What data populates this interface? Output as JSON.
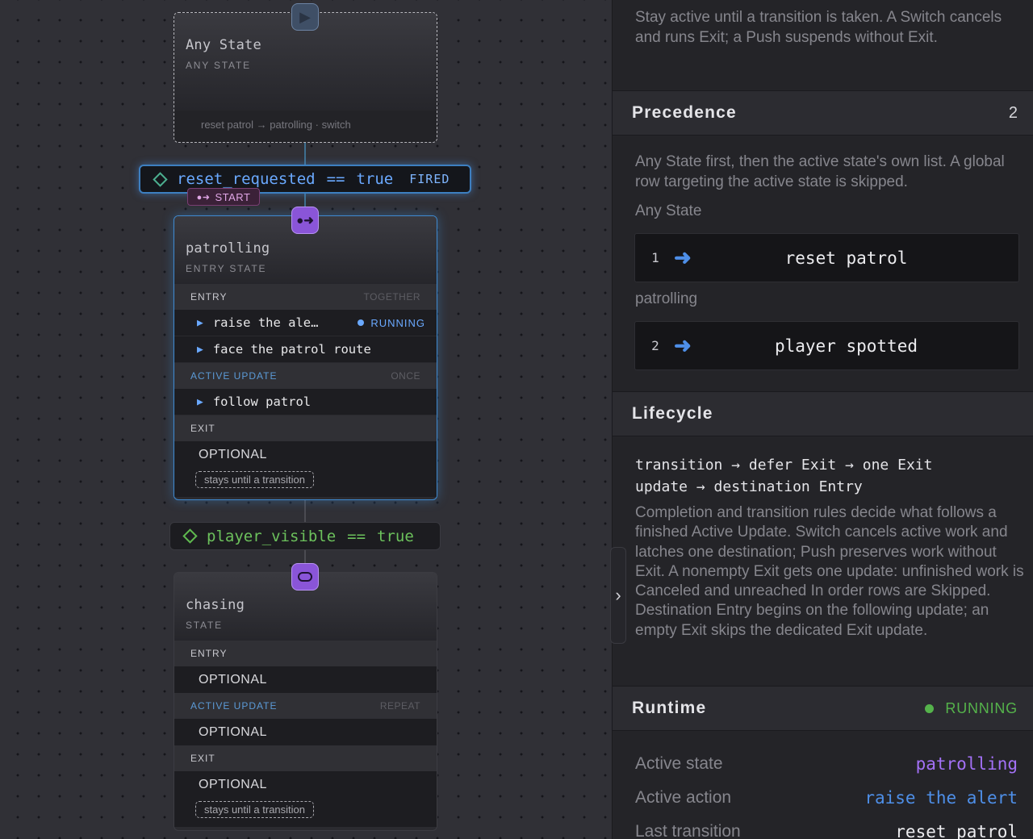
{
  "canvas": {
    "any_state": {
      "title": "Any State",
      "kind": "ANY STATE",
      "footer": "reset patrol → patrolling · switch"
    },
    "condition_reset": {
      "name": "reset_requested",
      "op": "==",
      "value": "true",
      "badge": "FIRED"
    },
    "start_badge": "START",
    "patrolling": {
      "title": "patrolling",
      "kind": "ENTRY STATE",
      "entry": {
        "label": "ENTRY",
        "mode": "TOGETHER",
        "rows": [
          {
            "text": "raise the ale…",
            "status": "RUNNING"
          },
          {
            "text": "face the patrol route"
          }
        ]
      },
      "active_update": {
        "label": "ACTIVE UPDATE",
        "mode": "ONCE",
        "rows": [
          {
            "text": "follow patrol"
          }
        ]
      },
      "exit": {
        "label": "EXIT",
        "optional": "OPTIONAL",
        "stays": "stays until a transition"
      }
    },
    "condition_player": {
      "name": "player_visible",
      "op": "==",
      "value": "true"
    },
    "chasing": {
      "title": "chasing",
      "kind": "STATE",
      "entry": {
        "label": "ENTRY",
        "optional": "OPTIONAL"
      },
      "active_update": {
        "label": "ACTIVE UPDATE",
        "mode": "REPEAT",
        "optional": "OPTIONAL"
      },
      "exit": {
        "label": "EXIT",
        "optional": "OPTIONAL",
        "stays": "stays until a transition"
      }
    }
  },
  "panel": {
    "intro_text": "Stay active until a transition is taken. A Switch cancels and runs Exit; a Push suspends without Exit.",
    "precedence": {
      "title": "Precedence",
      "count": "2",
      "description": "Any State first, then the active state's own list. A global row targeting the active state is skipped.",
      "groups": [
        {
          "name": "Any State",
          "index": "1",
          "label": "reset patrol"
        },
        {
          "name": "patrolling",
          "index": "2",
          "label": "player spotted"
        }
      ]
    },
    "lifecycle": {
      "title": "Lifecycle",
      "flow_line1": "transition → defer Exit → one Exit",
      "flow_line2": "update → destination Entry",
      "description": "Completion and transition rules decide what follows a finished Active Update. Switch cancels active work and latches one destination; Push preserves work without Exit. A nonempty Exit gets one update: unfinished work is Canceled and unreached In order rows are Skipped. Destination Entry begins on the following update; an empty Exit skips the dedicated Exit update."
    },
    "runtime": {
      "title": "Runtime",
      "status": "RUNNING",
      "rows": [
        {
          "key": "Active state",
          "value": "patrolling"
        },
        {
          "key": "Active action",
          "value": "raise the alert"
        },
        {
          "key": "Last transition",
          "value": "reset patrol"
        }
      ]
    }
  },
  "colors": {
    "accent_blue": "#6aa9ff",
    "condition_green": "#5fba4f",
    "state_purple": "#a371f7",
    "running_green": "#55b34b",
    "start_pink": "#e0a6e6"
  },
  "icons": {
    "any_state_port": "play-icon",
    "patrolling_port": "enter-arrow-icon",
    "chasing_port": "loop-icon",
    "condition": "diamond-icon",
    "collapse": "chevron-right-icon",
    "precedence_arrow": "arrow-right-icon"
  }
}
